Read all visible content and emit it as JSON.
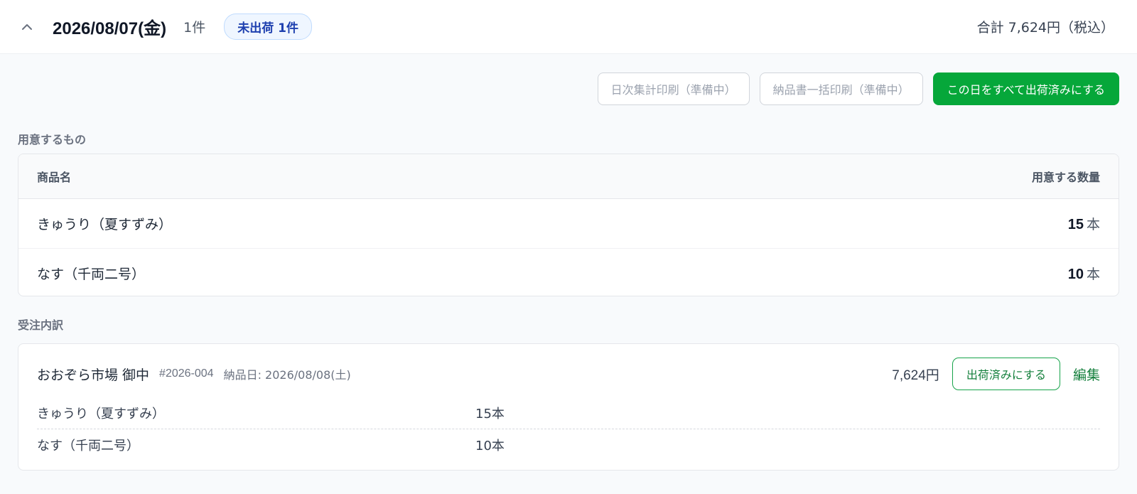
{
  "header": {
    "date": "2026/08/07(金)",
    "count": "1件",
    "status_badge": "未出荷 1件",
    "total": "合計 7,624円（税込）"
  },
  "actions": {
    "daily_print": "日次集計印刷（準備中）",
    "bulk_invoice_print": "納品書一括印刷（準備中）",
    "mark_all_shipped": "この日をすべて出荷済みにする"
  },
  "prep": {
    "title": "用意するもの",
    "col_name": "商品名",
    "col_qty": "用意する数量",
    "rows": [
      {
        "name": "きゅうり（夏すずみ）",
        "qty": "15",
        "unit": "本"
      },
      {
        "name": "なす（千両二号）",
        "qty": "10",
        "unit": "本"
      }
    ]
  },
  "orders": {
    "title": "受注内訳",
    "items": [
      {
        "customer": "おおぞら市場 御中",
        "order_no": "#2026-004",
        "delivery": "納品日: 2026/08/08(土)",
        "amount": "7,624円",
        "ship_label": "出荷済みにする",
        "edit_label": "編集",
        "lines": [
          {
            "name": "きゅうり（夏すずみ）",
            "qty": "15本"
          },
          {
            "name": "なす（千両二号）",
            "qty": "10本"
          }
        ]
      }
    ]
  },
  "colors": {
    "accent_green": "#06a73a",
    "badge_blue": "#1e40af"
  },
  "icons": {
    "collapse": "chevron-up-icon"
  }
}
